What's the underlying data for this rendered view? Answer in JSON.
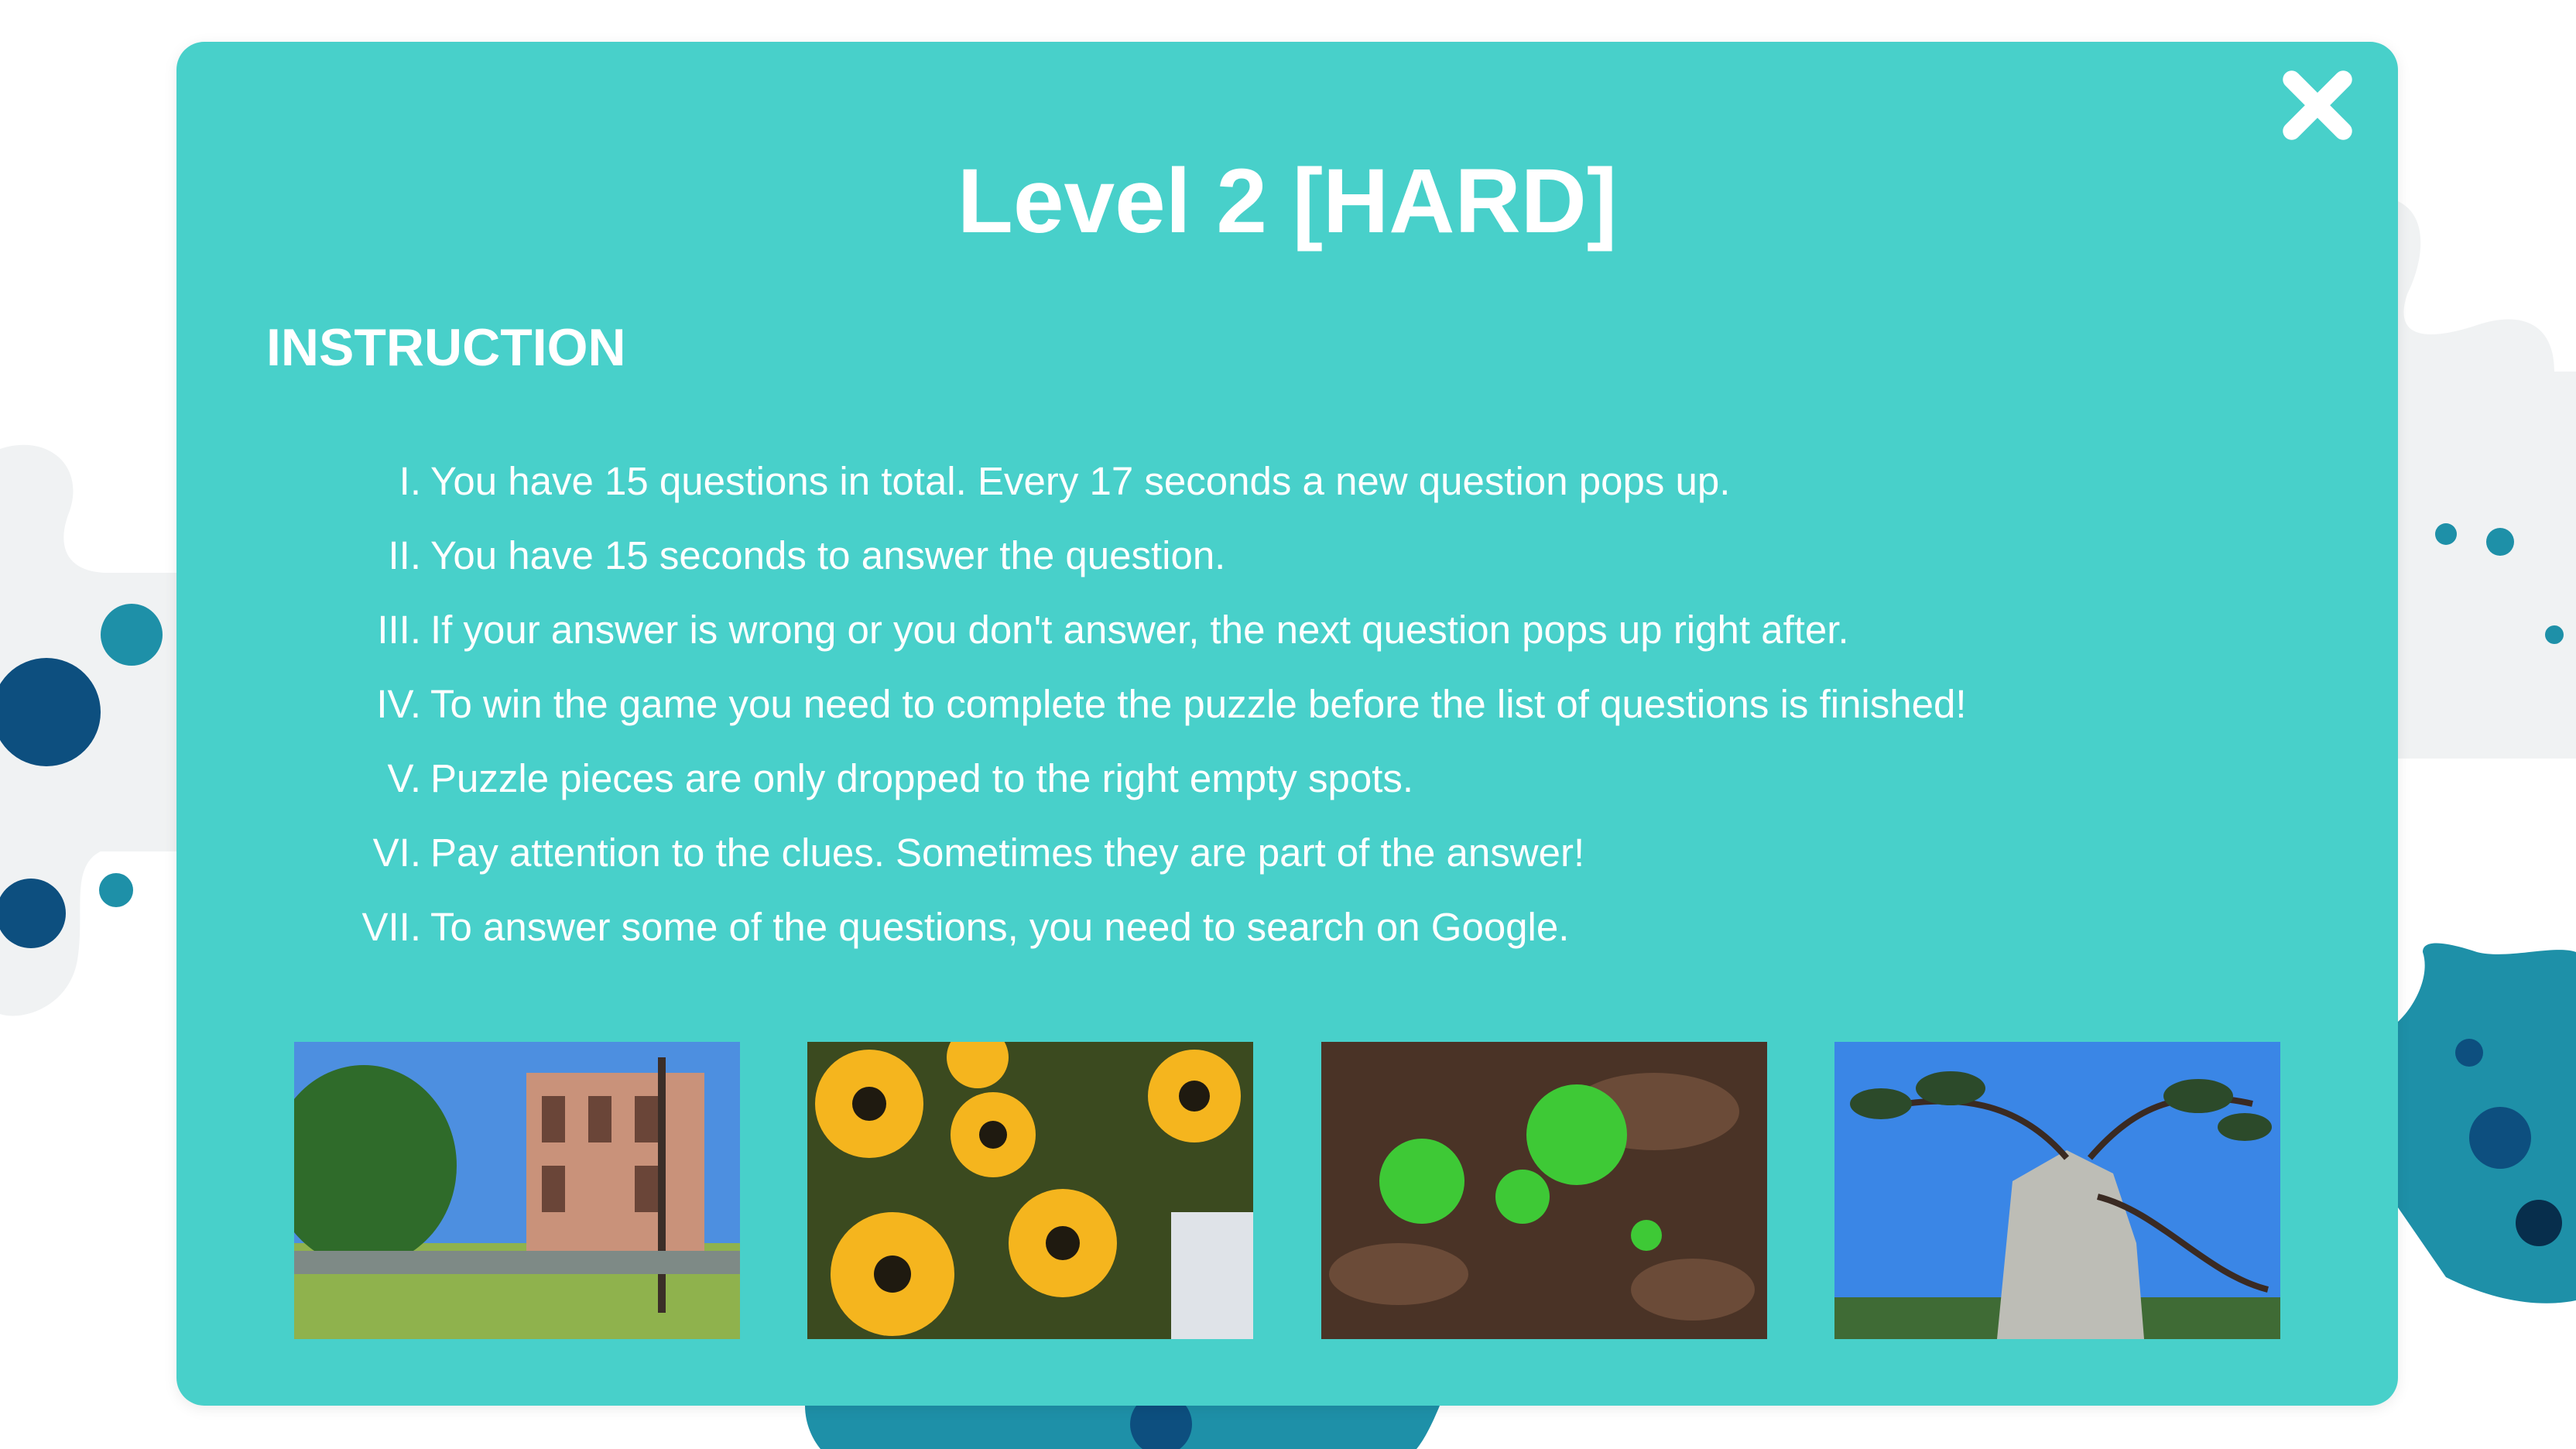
{
  "dialog": {
    "title": "Level 2 [HARD]",
    "section_heading": "INSTRUCTION",
    "close_icon": "close-icon",
    "rules": [
      {
        "num": "I.",
        "text": "You have 15 questions in total. Every 17 seconds a new question pops up."
      },
      {
        "num": "II.",
        "text": "You have 15 seconds to answer the question."
      },
      {
        "num": "III.",
        "text": "If your answer is wrong or you don't answer, the next question pops up right after."
      },
      {
        "num": "IV.",
        "text": "To win the game you need to complete the puzzle before the list of questions is finished!"
      },
      {
        "num": "V.",
        "text": "Puzzle pieces are only dropped to the right empty spots."
      },
      {
        "num": "VI.",
        "text": "Pay attention to the clues. Sometimes they are part of the answer!"
      },
      {
        "num": "VII.",
        "text": "To answer some of the questions, you need to search on Google."
      }
    ],
    "photos": [
      "city-square-photo",
      "yellow-flowers-photo",
      "green-plants-photo",
      "pine-on-rock-photo"
    ]
  },
  "colors": {
    "modal_bg": "#48d0ca",
    "text": "#ffffff",
    "puzzle_dark_blue": "#0d4f7f",
    "puzzle_teal": "#1e90a8"
  }
}
